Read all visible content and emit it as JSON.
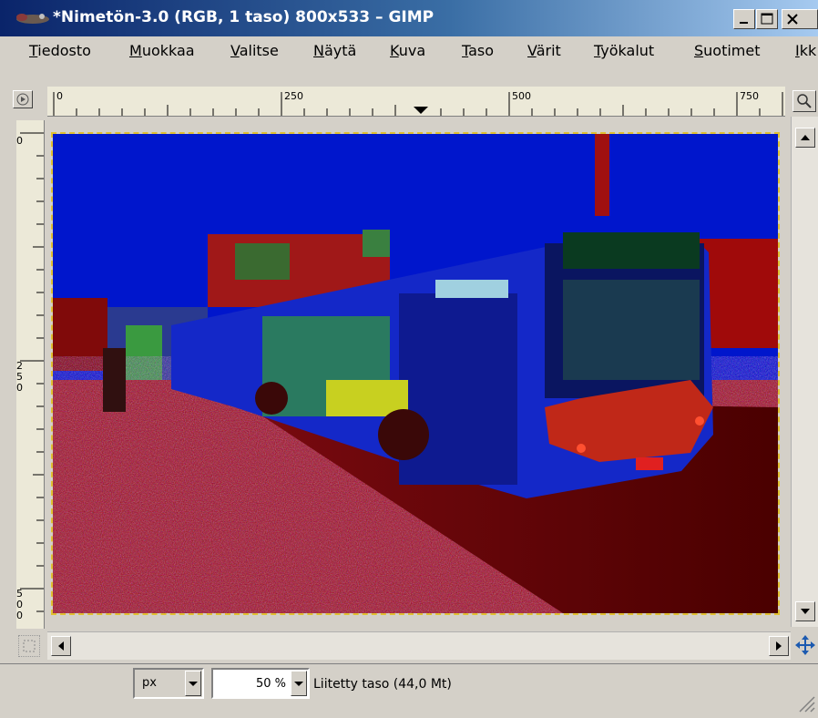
{
  "window": {
    "title": "*Nimetön-3.0 (RGB, 1 taso) 800x533 – GIMP",
    "icon": "gimp-wilber-icon",
    "controls": [
      "minimize-icon",
      "maximize-icon",
      "close-icon"
    ]
  },
  "menubar": {
    "items": [
      "Tiedosto",
      "Muokkaa",
      "Valitse",
      "Näytä",
      "Kuva",
      "Taso",
      "Värit",
      "Työkalut",
      "Suotimet",
      "Ikk"
    ]
  },
  "rulers": {
    "horizontal_labels": [
      "0",
      "250",
      "500",
      "750"
    ],
    "vertical_labels": [
      "0",
      "250",
      "500"
    ]
  },
  "canvas": {
    "image_description_icon": "photo-image",
    "colors": {
      "sky": "#0014d2",
      "bus": "#1a2ad0",
      "road": "#6a0000",
      "ground_noise": "#c02020"
    }
  },
  "statusbar": {
    "unit_value": "px",
    "zoom_value": "50 %",
    "message": "Liitetty taso (44,0 Mt)"
  }
}
